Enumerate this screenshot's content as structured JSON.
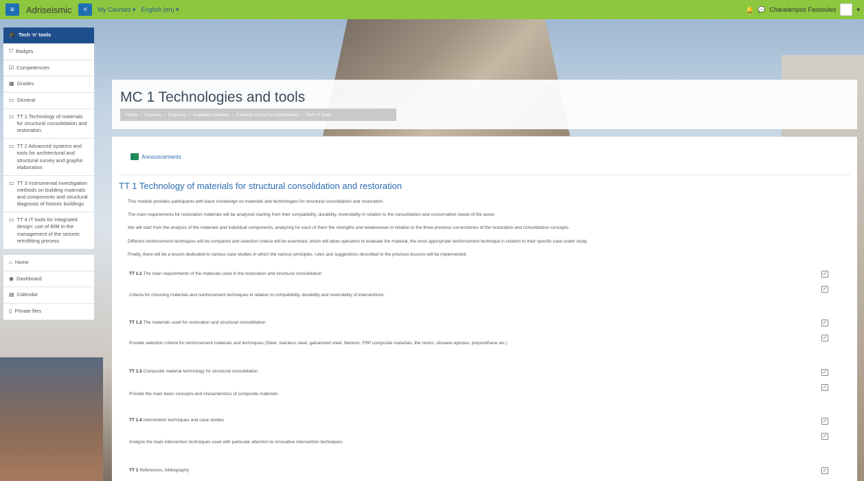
{
  "navbar": {
    "brand": "Adriseismic",
    "menu_icon": "hamburger-icon",
    "share_icon": "share-icon",
    "my_courses": "My Courses ▾",
    "language": "English (en) ▾",
    "user_name": "Charalampos Fassoules",
    "bell_icon": "bell-icon",
    "chat_icon": "chat-icon",
    "user_menu": "▾"
  },
  "sidebar": {
    "items": [
      {
        "label": "Tech 'n' tools",
        "icon": "graduation-cap-icon"
      },
      {
        "label": "Badges",
        "icon": "shield-icon"
      },
      {
        "label": "Competencies",
        "icon": "checkbox-icon"
      },
      {
        "label": "Grades",
        "icon": "table-icon"
      },
      {
        "label": "General",
        "icon": "folder-icon"
      },
      {
        "label": "TT 1 Technology of materials for structural consolidation and restoration",
        "icon": "folder-icon"
      },
      {
        "label": "TT 2 Advanced systems and tools for architectural and structural survey and graphic elaboration",
        "icon": "folder-icon"
      },
      {
        "label": "TT 3 Instrumental investigation methods on building materials and components and structural diagnosis of historic buildings",
        "icon": "folder-icon"
      },
      {
        "label": "TT 4 IT tools for integrated design: use of BIM in the management of the seismic retrofitting process",
        "icon": "folder-icon"
      }
    ],
    "items2": [
      {
        "label": "Home",
        "icon": "home-icon"
      },
      {
        "label": "Dashboard",
        "icon": "dashboard-icon"
      },
      {
        "label": "Calendar",
        "icon": "calendar-icon"
      },
      {
        "label": "Private files",
        "icon": "file-icon"
      }
    ]
  },
  "header": {
    "title": "MC 1 Technologies and tools",
    "breadcrumb": [
      "Home",
      "Courses",
      "Erasmus",
      "Available modules",
      "Training course for practitioners",
      "Tech 'n' tools"
    ]
  },
  "main": {
    "announcements": "Announcements",
    "section_title": "TT 1 Technology of materials for structural consolidation and restoration",
    "intro": [
      "This module provides participants with basic knowledge on materials and technologies for structural consolidation and restoration.",
      "The main requirements for restoration materials will be analyzed starting from their compatibility, durability, reversibility in relation to the consolidation and conservation needs of the asset.",
      "We will start from the analysis of the materials and individual components, analyzing for each of them the strengths and weaknesses in relation to the three previous cornerstones of the restoration and consolidation concepts.",
      "Different reinforcement techniques will be compared and selection criteria will be examined, which will allow operators to evaluate the material, the most appropriate reinforcement technique in relation to their specific case under study.",
      "Finally, there will be a lesson dedicated to various case studies in which the various principles, rules and suggestions described in the previous lessons will be implemented."
    ],
    "activities": [
      {
        "code": "TT 1.1",
        "title": "The main requirements of the materials used in the restoration and structural consolidation",
        "desc": "Criteria for choosing materials and reinforcement techniques in relation to compatibility, durability and reversibility of interventions."
      },
      {
        "code": "TT 1.2",
        "title": "The materials used for restoration and structural consolidation",
        "desc": "Provide selection criteria for reinforcement materials and techniques (Steel, stainless steel, galvanized steel, titanium, FRP composite materials, the resins, siloxane epoxies, polyurethane etc.)"
      },
      {
        "code": "TT 1.3",
        "title": "Composite material technology for structural consolidation",
        "desc": "Provide the main basic concepts and characteristics of composite materials."
      },
      {
        "code": "TT 1.4",
        "title": "Intervention techniques and case studies",
        "desc": "Analyze the main intervention techniques used with particular attention to innovative intervention techniques."
      },
      {
        "code": "TT 1",
        "title": "References, bibliography",
        "desc": ""
      }
    ],
    "check_glyph": "✓"
  }
}
